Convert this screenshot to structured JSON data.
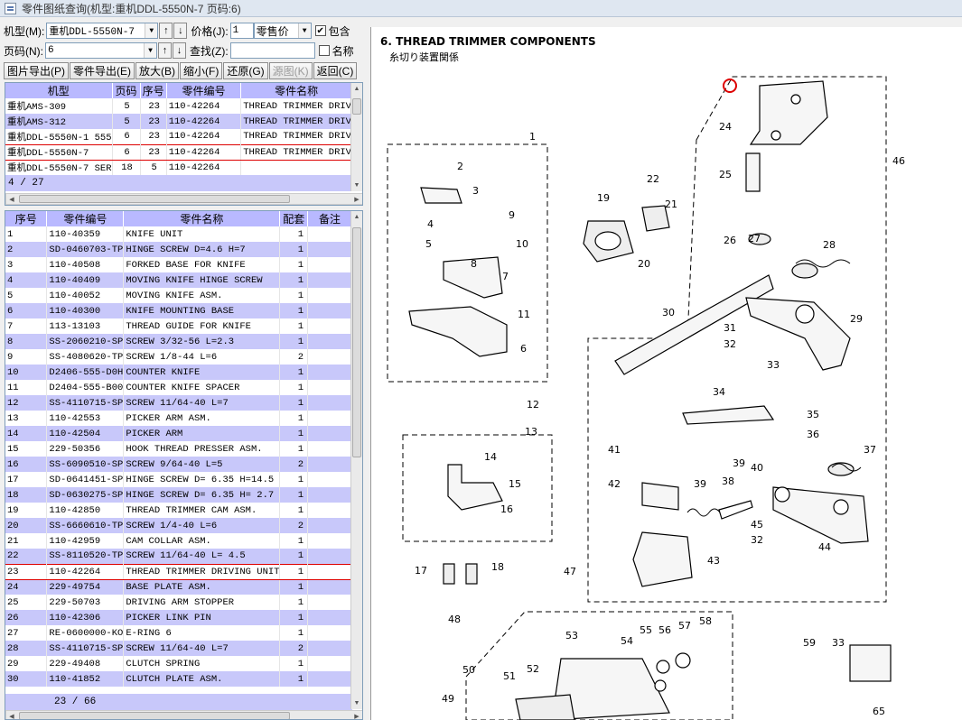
{
  "window_title": "零件图纸查询(机型:重机DDL-5550N-7 页码:6)",
  "filters": {
    "model_label": "机型(M):",
    "model_value": "重机DDL-5550N-7",
    "price_label": "价格(J):",
    "price_num": "1",
    "price_type": "零售价",
    "include_label": "包含",
    "page_label": "页码(N):",
    "page_value": "6",
    "search_label": "查找(Z):",
    "search_value": "",
    "name_label": "名称",
    "up": "↑",
    "down": "↓",
    "check": "✔",
    "combo_arrow": "▼"
  },
  "toolbar": [
    "图片导出(P)",
    "零件导出(E)",
    "放大(B)",
    "缩小(F)",
    "还原(G)",
    "源图(K)",
    "返回(C)"
  ],
  "model_grid": {
    "headers": [
      "机型",
      "页码",
      "序号",
      "零件编号",
      "零件名称"
    ],
    "rows": [
      [
        "重机AMS-309",
        "5",
        "23",
        "110-42264",
        "THREAD TRIMMER DRIV"
      ],
      [
        "重机AMS-312",
        "5",
        "23",
        "110-42264",
        "THREAD TRIMMER DRIV"
      ],
      [
        "重机DDL-5550N-1 555",
        "6",
        "23",
        "110-42264",
        "THREAD TRIMMER DRIV"
      ],
      [
        "重机DDL-5550N-7",
        "6",
        "23",
        "110-42264",
        "THREAD TRIMMER DRIV"
      ],
      [
        "重机DDL-5550N-7 SER",
        "18",
        "5",
        "110-42264",
        ""
      ]
    ],
    "count": "4 / 27"
  },
  "parts_grid": {
    "headers": [
      "序号",
      "零件编号",
      "零件名称",
      "配套",
      "备注"
    ],
    "rows": [
      [
        "1",
        "110-40359",
        "KNIFE UNIT",
        "1"
      ],
      [
        "2",
        "SD-0460703-TP",
        "HINGE SCREW D=4.6 H=7",
        "1"
      ],
      [
        "3",
        "110-40508",
        "FORKED BASE FOR KNIFE",
        "1"
      ],
      [
        "4",
        "110-40409",
        "MOVING KNIFE HINGE SCREW",
        "1"
      ],
      [
        "5",
        "110-40052",
        "MOVING KNIFE ASM.",
        "1"
      ],
      [
        "6",
        "110-40300",
        "KNIFE MOUNTING BASE",
        "1"
      ],
      [
        "7",
        "113-13103",
        "THREAD GUIDE FOR KNIFE",
        "1"
      ],
      [
        "8",
        "SS-2060210-SP",
        "SCREW 3/32-56 L=2.3",
        "1"
      ],
      [
        "9",
        "SS-4080620-TP",
        "SCREW 1/8-44 L=6",
        "2"
      ],
      [
        "10",
        "D2406-555-D0H",
        "COUNTER KNIFE",
        "1"
      ],
      [
        "11",
        "D2404-555-B00",
        "COUNTER KNIFE SPACER",
        "1"
      ],
      [
        "12",
        "SS-4110715-SP",
        "SCREW 11/64-40 L=7",
        "1"
      ],
      [
        "13",
        "110-42553",
        "PICKER ARM ASM.",
        "1"
      ],
      [
        "14",
        "110-42504",
        "PICKER ARM",
        "1"
      ],
      [
        "15",
        "229-50356",
        "HOOK THREAD PRESSER ASM.",
        "1"
      ],
      [
        "16",
        "SS-6090510-SP",
        "SCREW 9/64-40 L=5",
        "2"
      ],
      [
        "17",
        "SD-0641451-SP",
        "HINGE SCREW D= 6.35 H=14.5",
        "1"
      ],
      [
        "18",
        "SD-0630275-SP",
        "HINGE SCREW D= 6.35 H= 2.7",
        "1"
      ],
      [
        "19",
        "110-42850",
        "THREAD TRIMMER CAM ASM.",
        "1"
      ],
      [
        "20",
        "SS-6660610-TP",
        "SCREW 1/4-40 L=6",
        "2"
      ],
      [
        "21",
        "110-42959",
        "CAM COLLAR ASM.",
        "1"
      ],
      [
        "22",
        "SS-8110520-TP",
        "SCREW 11/64-40 L= 4.5",
        "1"
      ],
      [
        "23",
        "110-42264",
        "THREAD TRIMMER DRIVING UNIT",
        "1"
      ],
      [
        "24",
        "229-49754",
        "BASE PLATE ASM.",
        "1"
      ],
      [
        "25",
        "229-50703",
        "DRIVING ARM STOPPER",
        "1"
      ],
      [
        "26",
        "110-42306",
        "PICKER LINK PIN",
        "1"
      ],
      [
        "27",
        "RE-0600000-KO",
        "E-RING 6",
        "1"
      ],
      [
        "28",
        "SS-4110715-SP",
        "SCREW 11/64-40 L=7",
        "2"
      ],
      [
        "29",
        "229-49408",
        "CLUTCH SPRING",
        "1"
      ],
      [
        "30",
        "110-41852",
        "CLUTCH PLATE ASM.",
        "1"
      ]
    ],
    "count": "23 / 66"
  },
  "drawing": {
    "title": "6. THREAD TRIMMER COMPONENTS",
    "subtitle": "糸切り装置関係",
    "labels": [
      "1",
      "2",
      "3",
      "4",
      "5",
      "6",
      "7",
      "8",
      "9",
      "10",
      "11",
      "12",
      "13",
      "14",
      "15",
      "16",
      "17",
      "18",
      "19",
      "20",
      "21",
      "22",
      "23",
      "24",
      "25",
      "26",
      "27",
      "28",
      "29",
      "30",
      "31",
      "32",
      "33",
      "34",
      "35",
      "36",
      "37",
      "38",
      "39",
      "40",
      "39",
      "41",
      "42",
      "43",
      "44",
      "45",
      "32",
      "33",
      "46",
      "47",
      "48",
      "49",
      "50",
      "51",
      "52",
      "53",
      "54",
      "55",
      "56",
      "57",
      "58",
      "59",
      "65",
      "66"
    ]
  }
}
